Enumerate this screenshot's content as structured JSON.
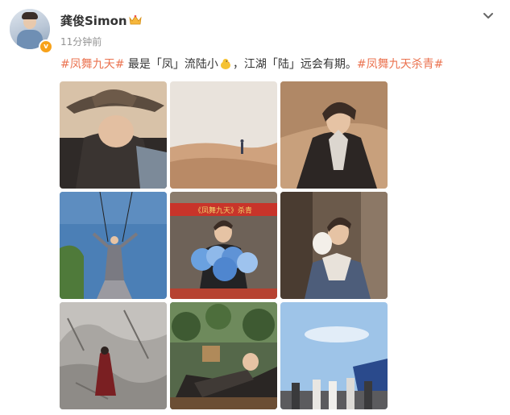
{
  "post": {
    "username": "龚俊Simon",
    "timestamp": "11分钟前",
    "text_segments": [
      {
        "kind": "tag",
        "text": "#凤舞九天#"
      },
      {
        "kind": "text",
        "text": " 最是「凤」流陆小"
      },
      {
        "kind": "emoji",
        "name": "chick-emoji"
      },
      {
        "kind": "text",
        "text": "，江湖「陆」远会有期。"
      },
      {
        "kind": "tag",
        "text": "#凤舞九天杀青#"
      }
    ],
    "photo_banner_text": "《凤舞九天》杀青"
  },
  "icons": {
    "avatar_badge": "verified-badge-icon",
    "name_badge": "crown-icon",
    "menu": "chevron-down-icon"
  },
  "colors": {
    "tag": "#eb7350",
    "username": "#333333",
    "timestamp": "#939393",
    "verified_badge": "#f7a21b"
  },
  "photos": [
    {
      "name": "photo-straw-hat"
    },
    {
      "name": "photo-desert"
    },
    {
      "name": "photo-desert-portrait"
    },
    {
      "name": "photo-wire-rig"
    },
    {
      "name": "photo-bouquet"
    },
    {
      "name": "photo-towel-portrait"
    },
    {
      "name": "photo-cliff"
    },
    {
      "name": "photo-garden-rest"
    },
    {
      "name": "photo-sky-crew"
    }
  ]
}
